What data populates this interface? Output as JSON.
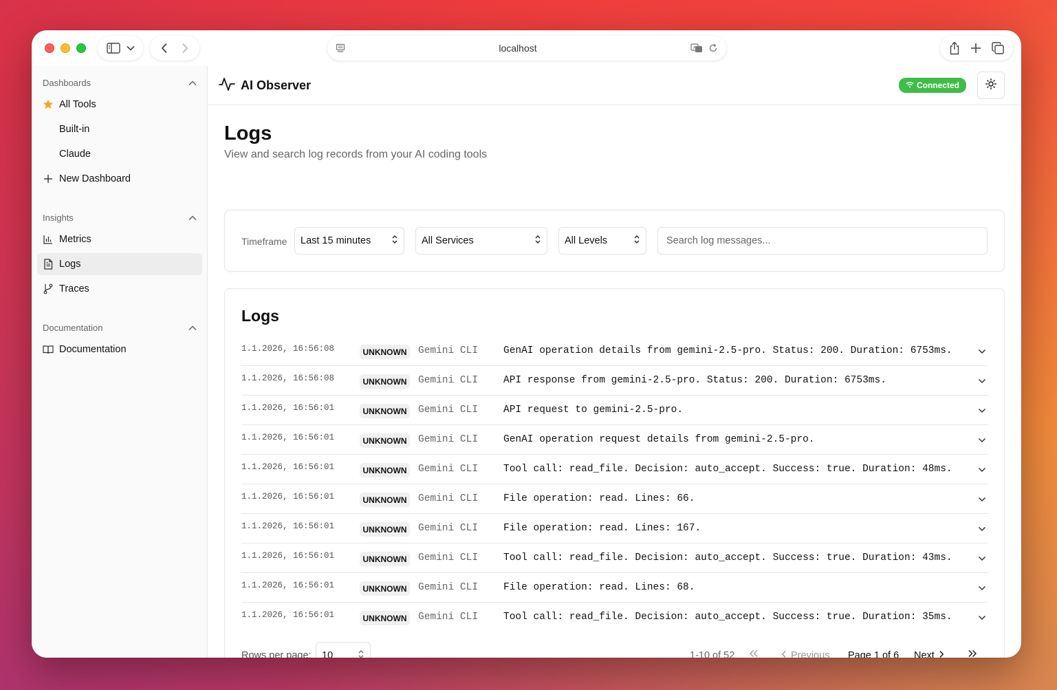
{
  "browser": {
    "url": "localhost"
  },
  "sidebar": {
    "sections": [
      {
        "title": "Dashboards",
        "items": [
          {
            "label": "All Tools",
            "icon": "star-icon"
          },
          {
            "label": "Built-in"
          },
          {
            "label": "Claude"
          },
          {
            "label": "New Dashboard",
            "icon": "plus-icon"
          }
        ]
      },
      {
        "title": "Insights",
        "items": [
          {
            "label": "Metrics",
            "icon": "bar-chart-icon"
          },
          {
            "label": "Logs",
            "icon": "document-icon",
            "active": true
          },
          {
            "label": "Traces",
            "icon": "git-branch-icon"
          }
        ]
      },
      {
        "title": "Documentation",
        "items": [
          {
            "label": "Documentation",
            "icon": "book-icon"
          }
        ]
      }
    ]
  },
  "header": {
    "app_name": "AI Observer",
    "status": "Connected",
    "status_color": "#3fbd48"
  },
  "page": {
    "title": "Logs",
    "subtitle": "View and search log records from your AI coding tools"
  },
  "filters": {
    "timeframe_label": "Timeframe",
    "timeframe": "Last 15 minutes",
    "service": "All Services",
    "level": "All Levels",
    "search_placeholder": "Search log messages..."
  },
  "logs": {
    "title": "Logs",
    "rows": [
      {
        "time": "1.1.2026, 16:56:08",
        "level": "UNKNOWN",
        "service": "Gemini CLI",
        "message": "GenAI operation details from gemini-2.5-pro. Status: 200. Duration: 6753ms."
      },
      {
        "time": "1.1.2026, 16:56:08",
        "level": "UNKNOWN",
        "service": "Gemini CLI",
        "message": "API response from gemini-2.5-pro. Status: 200. Duration: 6753ms."
      },
      {
        "time": "1.1.2026, 16:56:01",
        "level": "UNKNOWN",
        "service": "Gemini CLI",
        "message": "API request to gemini-2.5-pro."
      },
      {
        "time": "1.1.2026, 16:56:01",
        "level": "UNKNOWN",
        "service": "Gemini CLI",
        "message": "GenAI operation request details from gemini-2.5-pro."
      },
      {
        "time": "1.1.2026, 16:56:01",
        "level": "UNKNOWN",
        "service": "Gemini CLI",
        "message": "Tool call: read_file. Decision: auto_accept. Success: true. Duration: 48ms."
      },
      {
        "time": "1.1.2026, 16:56:01",
        "level": "UNKNOWN",
        "service": "Gemini CLI",
        "message": "File operation: read. Lines: 66."
      },
      {
        "time": "1.1.2026, 16:56:01",
        "level": "UNKNOWN",
        "service": "Gemini CLI",
        "message": "File operation: read. Lines: 167."
      },
      {
        "time": "1.1.2026, 16:56:01",
        "level": "UNKNOWN",
        "service": "Gemini CLI",
        "message": "Tool call: read_file. Decision: auto_accept. Success: true. Duration: 43ms."
      },
      {
        "time": "1.1.2026, 16:56:01",
        "level": "UNKNOWN",
        "service": "Gemini CLI",
        "message": "File operation: read. Lines: 68."
      },
      {
        "time": "1.1.2026, 16:56:01",
        "level": "UNKNOWN",
        "service": "Gemini CLI",
        "message": "Tool call: read_file. Decision: auto_accept. Success: true. Duration: 35ms."
      }
    ]
  },
  "pagination": {
    "rows_per_page_label": "Rows per page:",
    "rows_per_page": "10",
    "range": "1-10 of 52",
    "previous": "Previous",
    "page_info": "Page 1 of 6",
    "next": "Next"
  }
}
